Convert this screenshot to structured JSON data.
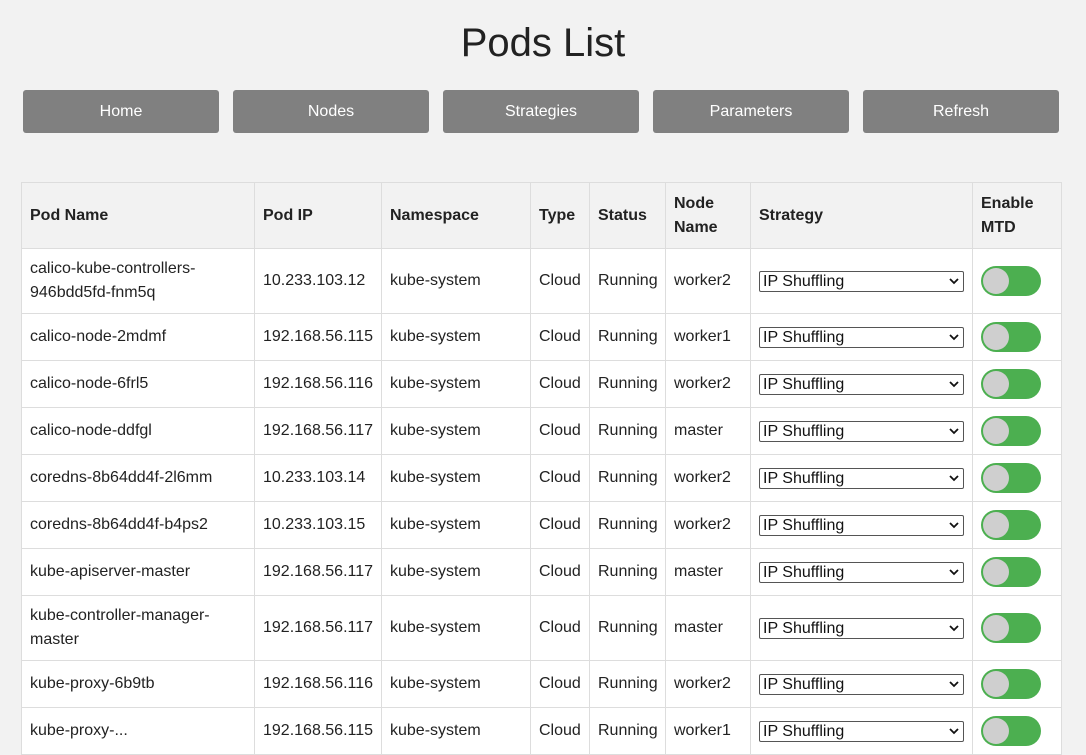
{
  "page": {
    "title": "Pods List"
  },
  "nav": {
    "buttons": [
      "Home",
      "Nodes",
      "Strategies",
      "Parameters",
      "Refresh"
    ]
  },
  "table": {
    "headers": [
      "Pod Name",
      "Pod IP",
      "Namespace",
      "Type",
      "Status",
      "Node Name",
      "Strategy",
      "Enable MTD"
    ],
    "rows": [
      {
        "name": "calico-kube-controllers-946bdd5fd-fnm5q",
        "ip": "10.233.103.12",
        "namespace": "kube-system",
        "type": "Cloud",
        "status": "Running",
        "node": "worker2",
        "strategy": "IP Shuffling",
        "mtd_enabled": true
      },
      {
        "name": "calico-node-2mdmf",
        "ip": "192.168.56.115",
        "namespace": "kube-system",
        "type": "Cloud",
        "status": "Running",
        "node": "worker1",
        "strategy": "IP Shuffling",
        "mtd_enabled": true
      },
      {
        "name": "calico-node-6frl5",
        "ip": "192.168.56.116",
        "namespace": "kube-system",
        "type": "Cloud",
        "status": "Running",
        "node": "worker2",
        "strategy": "IP Shuffling",
        "mtd_enabled": true
      },
      {
        "name": "calico-node-ddfgl",
        "ip": "192.168.56.117",
        "namespace": "kube-system",
        "type": "Cloud",
        "status": "Running",
        "node": "master",
        "strategy": "IP Shuffling",
        "mtd_enabled": true
      },
      {
        "name": "coredns-8b64dd4f-2l6mm",
        "ip": "10.233.103.14",
        "namespace": "kube-system",
        "type": "Cloud",
        "status": "Running",
        "node": "worker2",
        "strategy": "IP Shuffling",
        "mtd_enabled": true
      },
      {
        "name": "coredns-8b64dd4f-b4ps2",
        "ip": "10.233.103.15",
        "namespace": "kube-system",
        "type": "Cloud",
        "status": "Running",
        "node": "worker2",
        "strategy": "IP Shuffling",
        "mtd_enabled": true
      },
      {
        "name": "kube-apiserver-master",
        "ip": "192.168.56.117",
        "namespace": "kube-system",
        "type": "Cloud",
        "status": "Running",
        "node": "master",
        "strategy": "IP Shuffling",
        "mtd_enabled": true
      },
      {
        "name": "kube-controller-manager-master",
        "ip": "192.168.56.117",
        "namespace": "kube-system",
        "type": "Cloud",
        "status": "Running",
        "node": "master",
        "strategy": "IP Shuffling",
        "mtd_enabled": true
      },
      {
        "name": "kube-proxy-6b9tb",
        "ip": "192.168.56.116",
        "namespace": "kube-system",
        "type": "Cloud",
        "status": "Running",
        "node": "worker2",
        "strategy": "IP Shuffling",
        "mtd_enabled": true
      },
      {
        "name": "kube-proxy-...",
        "ip": "192.168.56.115",
        "namespace": "kube-system",
        "type": "Cloud",
        "status": "Running",
        "node": "worker1",
        "strategy": "IP Shuffling",
        "mtd_enabled": true
      }
    ]
  },
  "colors": {
    "background": "#f2f2f2",
    "button": "#808080",
    "toggle_on": "#4caf50",
    "toggle_knob": "#cfcfcf"
  },
  "icons": {
    "select_caret": "chevron-down-icon"
  }
}
